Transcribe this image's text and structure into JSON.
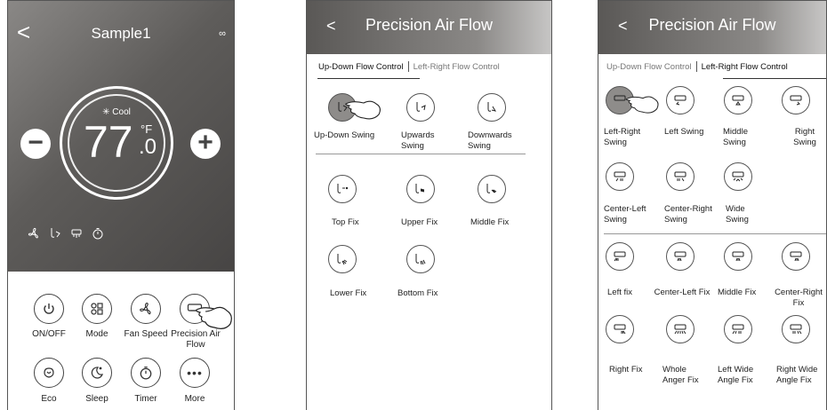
{
  "screen1": {
    "back": "<",
    "title": "Sample1",
    "more_dots": "∞",
    "mode": "✳ Cool",
    "temperature": "77",
    "decimal": ".0",
    "unit": "°F",
    "minus": "−",
    "plus": "+",
    "status_icons": [
      "fan-icon",
      "vertical-swing-icon",
      "horizontal-swing-icon",
      "timer-icon"
    ],
    "controls": [
      {
        "label": "ON/OFF",
        "icon": "power-icon"
      },
      {
        "label": "Mode",
        "icon": "mode-icon"
      },
      {
        "label": "Fan Speed",
        "icon": "fan-icon"
      },
      {
        "label": "Precision Air Flow",
        "icon": "airflow-icon"
      },
      {
        "label": "Eco",
        "icon": "eco-leaf-icon"
      },
      {
        "label": "Sleep",
        "icon": "sleep-icon"
      },
      {
        "label": "Timer",
        "icon": "timer-icon"
      },
      {
        "label": "More",
        "icon": "more-icon"
      }
    ]
  },
  "screen2": {
    "back": "<",
    "title": "Precision Air Flow",
    "tab_active": "Up-Down Flow Control",
    "tab_inactive": "Left-Right Flow Control",
    "swing": [
      {
        "label": "Up-Down Swing",
        "selected": true
      },
      {
        "label": "Upwards Swing",
        "selected": false
      },
      {
        "label": "Downwards Swing",
        "selected": false
      }
    ],
    "fixes": [
      {
        "label": "Top Fix"
      },
      {
        "label": "Upper Fix"
      },
      {
        "label": "Middle Fix"
      },
      {
        "label": "Lower Fix"
      },
      {
        "label": "Bottom Fix"
      }
    ]
  },
  "screen3": {
    "back": "<",
    "title": "Precision Air Flow",
    "tab_inactive": "Up-Down Flow Control",
    "tab_active": "Left-Right Flow Control",
    "swing": [
      {
        "label": "Left-Right Swing",
        "selected": true
      },
      {
        "label": "Left Swing",
        "selected": false
      },
      {
        "label": "Middle Swing",
        "selected": false
      },
      {
        "label": "Right Swing",
        "selected": false
      },
      {
        "label": "Center-Left Swing",
        "selected": false
      },
      {
        "label": "Center-Right Swing",
        "selected": false
      },
      {
        "label": "Wide Swing",
        "selected": false
      }
    ],
    "fixes": [
      {
        "label": "Left fix"
      },
      {
        "label": "Center-Left Fix"
      },
      {
        "label": "Middle Fix"
      },
      {
        "label": "Center-Right Fix"
      },
      {
        "label": "Right Fix"
      },
      {
        "label": "Whole Anger Fix"
      },
      {
        "label": "Left Wide Angle Fix"
      },
      {
        "label": "Right Wide Angle Fix"
      }
    ]
  }
}
